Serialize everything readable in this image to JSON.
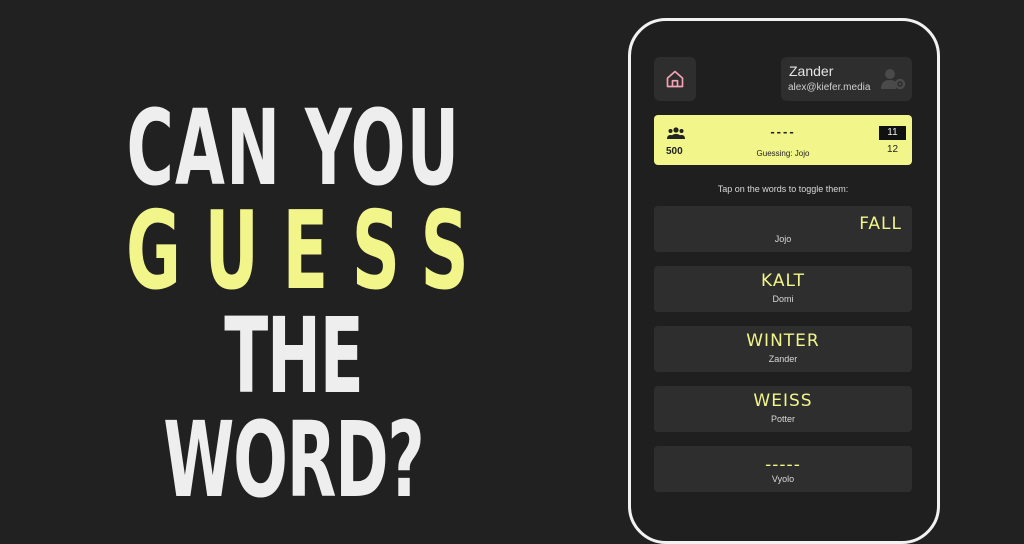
{
  "headline": {
    "line1": "CAN YOU",
    "line2": "GUESS",
    "line3": "THE WORD?"
  },
  "colors": {
    "accent": "#f2f58a",
    "background": "#212121",
    "card": "#2e2e2e"
  },
  "app": {
    "icons": {
      "home": "home-icon",
      "profile": "user-settings-icon",
      "players": "group-icon"
    },
    "user": {
      "name": "Zander",
      "email": "alex@kiefer.media"
    },
    "status": {
      "score": "500",
      "word_mask": "----",
      "guessing": "Guessing: Jojo",
      "round": "11",
      "total": "12"
    },
    "hint": "Tap on the words to toggle them:",
    "cards": [
      {
        "word": "FALL",
        "player": "Jojo"
      },
      {
        "word": "KALT",
        "player": "Domi"
      },
      {
        "word": "WINTER",
        "player": "Zander"
      },
      {
        "word": "WEISS",
        "player": "Potter"
      },
      {
        "word": "-----",
        "player": "Vyolo"
      }
    ]
  }
}
